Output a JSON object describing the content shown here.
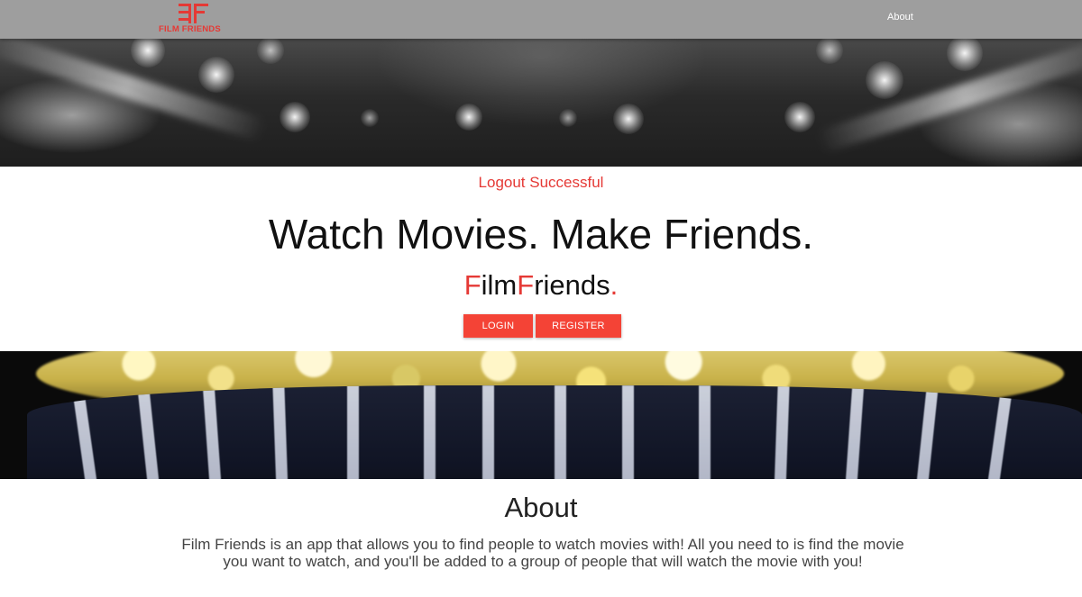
{
  "navbar": {
    "logo_text": "FILM FRIENDS",
    "about_link": "About"
  },
  "hero": {
    "status_message": "Logout Successful",
    "headline": "Watch Movies. Make Friends.",
    "brand": {
      "part1_accent": "F",
      "part1_rest": "ilm",
      "part2_accent": "F",
      "part2_rest": "riends",
      "dot": "."
    },
    "login_button": "LOGIN",
    "register_button": "REGISTER"
  },
  "about": {
    "title": "About",
    "description": "Film Friends is an app that allows you to find people to watch movies with! All you need to is find the movie you want to watch, and you'll be added to a group of people that will watch the movie with you!"
  },
  "colors": {
    "accent": "#f44336",
    "navbar": "#9e9e9e",
    "status_text": "#e53935"
  },
  "images": {
    "top_banner": "blurred-cinema-lights-image",
    "bottom_banner": "popcorn-bucket-image"
  }
}
